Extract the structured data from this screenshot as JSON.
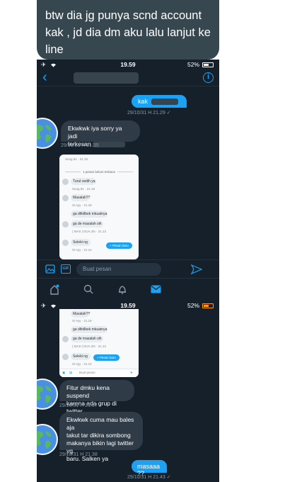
{
  "caption": "btw dia jg punya scnd account kak , jd dia dm aku lalu lanjut ke line",
  "status_bar": {
    "time": "19.59",
    "battery": "52%"
  },
  "chat1": {
    "sent": {
      "text": "kak",
      "meta": "29/10/31 H 21.29 ✓"
    },
    "received": {
      "text_1": "Ekwkwk iya sorry ya jadi",
      "text_2": "terkesan",
      "meta": "29/10/31 H 21.35"
    },
    "composer_placeholder": "Buat pesan"
  },
  "embedded_shot": {
    "divider": "1 pesan belum terbaca",
    "items": [
      {
        "text": "Turut sedih ya",
        "meta": "Sung 81 · 21.18"
      },
      {
        "text": "Masalah??",
        "meta": "Si Ayy · 21.18"
      },
      {
        "text": "ga difollbek mkuatnya",
        "meta": "Si Ayy · 21.18"
      },
      {
        "text": "ga de masalah sih",
        "meta": "( MAS | DUA.2N · 21.13"
      },
      {
        "text": "Selebi ng",
        "meta": "Si Ayy · 21.14"
      }
    ],
    "fab_label": "+ Pesan baru",
    "composer_placeholder": "Buat pesan"
  },
  "embedded_shot2": {
    "items": [
      {
        "text": "Masalah??",
        "meta": "Si Ayy · 21.18"
      },
      {
        "text": "ga difollbek mkuatnya",
        "meta": ""
      },
      {
        "text": "ga de masalah sih",
        "meta": "( MAS | DUA.2N · 21.13"
      },
      {
        "text": "Selebi ng",
        "meta": "Si Ayy · 21.14"
      }
    ],
    "fab_label": "+ Pesan baru",
    "composer_placeholder": "Buat pesan"
  },
  "chat2": {
    "msg1": {
      "line1": "Fitur dmku kena suspend",
      "line2": "karena ada grup di twitter",
      "meta": "29/10/31 H 21.37"
    },
    "msg2": {
      "line1": "Ekwkwk cuma mau bales aja",
      "line2": "takut tar dikira sombong",
      "line3": "makanya bikin lagi twitter yg",
      "line4": "baru. Salken ya",
      "meta": "29/10/31 H 21.38"
    },
    "sent": {
      "text": "masaaa ??",
      "meta": "29/10/31 H 21.43 ✓"
    }
  },
  "colors": {
    "bg": "#15202b",
    "accent": "#1da1f2",
    "bubble_in": "#2f3b47",
    "caption_bg": "#37474f"
  },
  "icons": [
    "airplane-icon",
    "wifi-icon",
    "battery-icon",
    "back-arrow-icon",
    "info-icon",
    "image-icon",
    "gif-icon",
    "send-icon",
    "home-icon",
    "search-icon",
    "bell-icon",
    "mail-icon",
    "globe-avatar-icon"
  ]
}
